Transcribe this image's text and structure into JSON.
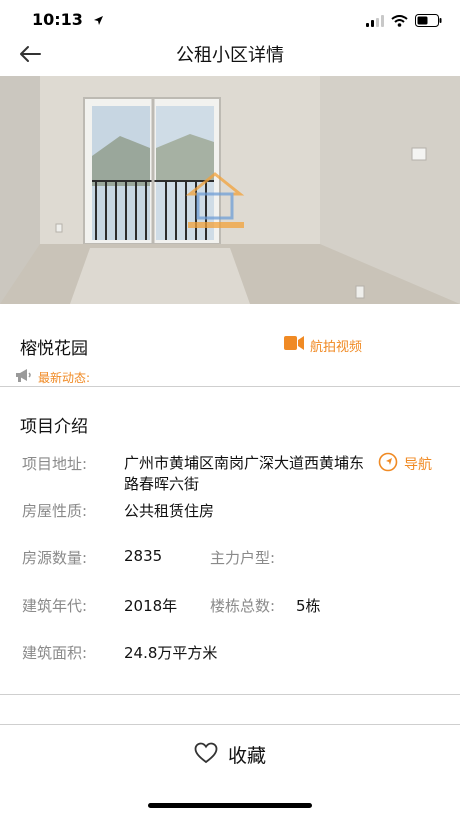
{
  "status_bar": {
    "time": "10:13"
  },
  "header": {
    "title": "公租小区详情"
  },
  "estate": {
    "name": "榕悦花园",
    "video_label": "航拍视频",
    "news_label": "最新动态:"
  },
  "intro": {
    "section_title": "项目介绍",
    "navigate_label": "导航",
    "fields": {
      "address_label": "项目地址:",
      "address_value": "广州市黄埔区南岗广深大道西黄埔东路春晖六街",
      "type_label": "房屋性质:",
      "type_value": "公共租赁住房",
      "units_label": "房源数量:",
      "units_value": "2835",
      "main_layout_label": "主力户型:",
      "main_layout_value": "",
      "year_label": "建筑年代:",
      "year_value": "2018年",
      "buildings_label": "楼栋总数:",
      "buildings_value": "5栋",
      "area_label": "建筑面积:",
      "area_value": "24.8万平方米"
    }
  },
  "footer": {
    "favorite_label": "收藏"
  },
  "colors": {
    "accent": "#f08a24",
    "label_gray": "#8a8a8a",
    "divider": "#cfcfcf"
  },
  "icons": {
    "back": "arrow-left-icon",
    "video": "video-camera-icon",
    "news": "megaphone-icon",
    "navigate": "navigation-compass-icon",
    "favorite": "heart-outline-icon"
  }
}
